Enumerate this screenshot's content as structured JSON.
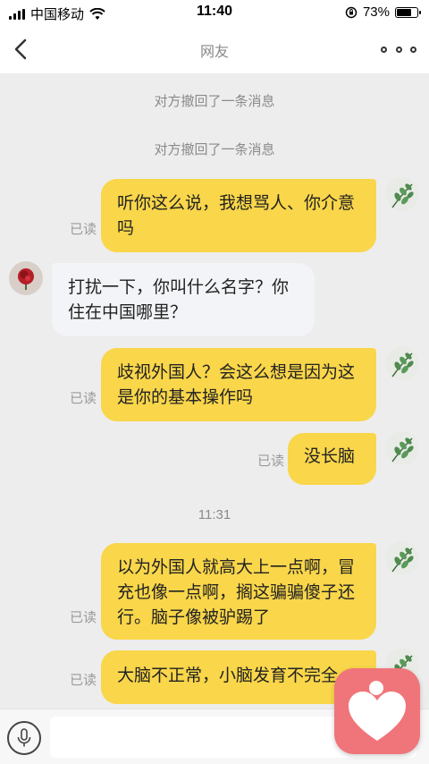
{
  "status_bar": {
    "carrier": "中国移动",
    "time": "11:40",
    "battery": "73%",
    "battery_level": 0.73
  },
  "header": {
    "title": "网友"
  },
  "chat": {
    "system_notices": [
      "对方撤回了一条消息",
      "对方撤回了一条消息"
    ],
    "timestamp": "11:31",
    "read_label": "已读",
    "messages": [
      {
        "from": "me",
        "text": "听你这么说，我想骂人、你介意吗",
        "read": "已读"
      },
      {
        "from": "other",
        "text": "打扰一下，你叫什么名字？你住在中国哪里？"
      },
      {
        "from": "me",
        "text": "歧视外国人？会这么想是因为这是你的基本操作吗",
        "read": "已读"
      },
      {
        "from": "me",
        "text": "没长脑",
        "read": "已读"
      },
      {
        "from": "me",
        "text": "以为外国人就高大上一点啊，冒充也像一点啊，搁这骗骗傻子还行。脑子像被驴踢了",
        "read": "已读"
      },
      {
        "from": "me",
        "text": "大脑不正常，小脑发育不完全",
        "read": "已读"
      }
    ]
  },
  "input_bar": {
    "placeholder": ""
  },
  "colors": {
    "my_bubble": "#f9d64a",
    "other_bubble": "#f2f4f7",
    "chat_background": "#ededed",
    "floating_app": "#f0757a"
  },
  "icons": {
    "back": "chevron-left-icon",
    "more": "more-dots-icon",
    "mic": "microphone-icon",
    "wifi": "wifi-icon",
    "rotation_lock": "rotation-lock-icon",
    "floating_app": "heart-app-icon"
  }
}
